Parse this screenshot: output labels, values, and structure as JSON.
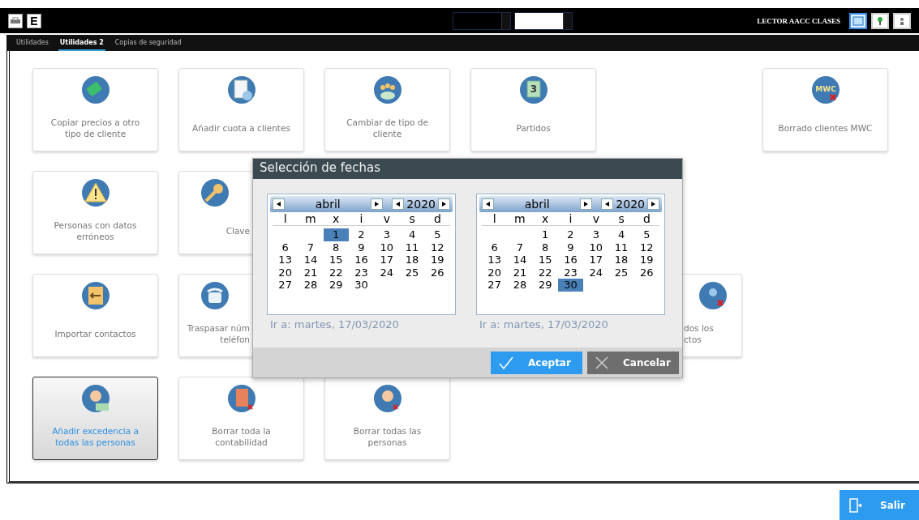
{
  "toolbar": {
    "user": "LECTOR AACC CLASES",
    "left_buttons": [
      {
        "kind": "printer"
      },
      {
        "kind": "letter",
        "label": "E"
      }
    ]
  },
  "tabs": [
    {
      "label": "Utilidades",
      "selected": false
    },
    {
      "label": "Utilidades 2",
      "selected": true
    },
    {
      "label": "Copias de seguridad",
      "selected": false
    }
  ],
  "tiles": [
    {
      "kind": "tile",
      "label": "Copiar precios a otro tipo de cliente",
      "selected": false
    },
    {
      "kind": "tile",
      "label": "Añadir cuota a clientes",
      "selected": false
    },
    {
      "kind": "tile",
      "label": "Cambiar de tipo de cliente",
      "selected": false
    },
    {
      "kind": "tile",
      "label": "Partidos",
      "selected": false,
      "icon_text": "3"
    },
    {
      "kind": "blank"
    },
    {
      "kind": "tile",
      "label": "Borrado clientes MWC",
      "selected": false,
      "icon_text": "MWC"
    },
    {
      "kind": "tile",
      "label": "Personas con datos erróneos",
      "selected": false
    },
    {
      "kind": "cutright",
      "label": "Clave",
      "selected": false
    },
    {
      "kind": "blank"
    },
    {
      "kind": "blank"
    },
    {
      "kind": "blank"
    },
    {
      "kind": "blank"
    },
    {
      "kind": "tile",
      "label": "Importar contactos",
      "selected": false
    },
    {
      "kind": "cutright",
      "label": "Traspasar núm\nteléfon",
      "selected": false
    },
    {
      "kind": "blank"
    },
    {
      "kind": "blank"
    },
    {
      "kind": "cutleft",
      "label": "dos los\nctos",
      "selected": false
    },
    {
      "kind": "blank"
    },
    {
      "kind": "tile",
      "label": "Añadir excedencia a todas las personas",
      "selected": true
    },
    {
      "kind": "tile",
      "label": "Borrar toda la contabilidad",
      "selected": false
    },
    {
      "kind": "tile",
      "label": "Borrar todas las personas",
      "selected": false
    }
  ],
  "dialog": {
    "title": "Selección de fechas",
    "calendars": [
      {
        "month": "abril",
        "year": "2020",
        "weekdays": [
          "l",
          "m",
          "x",
          "i",
          "v",
          "s",
          "d"
        ],
        "goto": "Ir a: martes, 17/03/2020",
        "weeks": [
          {
            "kind": "first",
            "days": [
              {
                "day": "1",
                "selected": true
              },
              {
                "day": "2",
                "selected": false
              },
              {
                "day": "3",
                "selected": false
              },
              {
                "day": "4",
                "selected": false
              },
              {
                "day": "5",
                "selected": false
              }
            ]
          },
          {
            "kind": "full",
            "days": [
              {
                "day": "6",
                "selected": false
              },
              {
                "day": "7",
                "selected": false
              },
              {
                "day": "8",
                "selected": false
              },
              {
                "day": "9",
                "selected": false
              },
              {
                "day": "10",
                "selected": false
              },
              {
                "day": "11",
                "selected": false
              },
              {
                "day": "12",
                "selected": false
              }
            ]
          },
          {
            "kind": "full",
            "days": [
              {
                "day": "13",
                "selected": false
              },
              {
                "day": "14",
                "selected": false
              },
              {
                "day": "15",
                "selected": false
              },
              {
                "day": "16",
                "selected": false
              },
              {
                "day": "17",
                "selected": false
              },
              {
                "day": "18",
                "selected": false
              },
              {
                "day": "19",
                "selected": false
              }
            ]
          },
          {
            "kind": "full",
            "days": [
              {
                "day": "20",
                "selected": false
              },
              {
                "day": "21",
                "selected": false
              },
              {
                "day": "22",
                "selected": false
              },
              {
                "day": "23",
                "selected": false
              },
              {
                "day": "24",
                "selected": false
              },
              {
                "day": "25",
                "selected": false
              },
              {
                "day": "26",
                "selected": false
              }
            ]
          },
          {
            "kind": "last",
            "days": [
              {
                "day": "27",
                "selected": false
              },
              {
                "day": "28",
                "selected": false
              },
              {
                "day": "29",
                "selected": false
              },
              {
                "day": "30",
                "selected": false
              }
            ]
          }
        ]
      },
      {
        "month": "abril",
        "year": "2020",
        "weekdays": [
          "l",
          "m",
          "x",
          "i",
          "v",
          "s",
          "d"
        ],
        "goto": "Ir a: martes, 17/03/2020",
        "weeks": [
          {
            "kind": "first",
            "days": [
              {
                "day": "1",
                "selected": false
              },
              {
                "day": "2",
                "selected": false
              },
              {
                "day": "3",
                "selected": false
              },
              {
                "day": "4",
                "selected": false
              },
              {
                "day": "5",
                "selected": false
              }
            ]
          },
          {
            "kind": "full",
            "days": [
              {
                "day": "6",
                "selected": false
              },
              {
                "day": "7",
                "selected": false
              },
              {
                "day": "8",
                "selected": false
              },
              {
                "day": "9",
                "selected": false
              },
              {
                "day": "10",
                "selected": false
              },
              {
                "day": "11",
                "selected": false
              },
              {
                "day": "12",
                "selected": false
              }
            ]
          },
          {
            "kind": "full",
            "days": [
              {
                "day": "13",
                "selected": false
              },
              {
                "day": "14",
                "selected": false
              },
              {
                "day": "15",
                "selected": false
              },
              {
                "day": "16",
                "selected": false
              },
              {
                "day": "17",
                "selected": false
              },
              {
                "day": "18",
                "selected": false
              },
              {
                "day": "19",
                "selected": false
              }
            ]
          },
          {
            "kind": "full",
            "days": [
              {
                "day": "20",
                "selected": false
              },
              {
                "day": "21",
                "selected": false
              },
              {
                "day": "22",
                "selected": false
              },
              {
                "day": "23",
                "selected": false
              },
              {
                "day": "24",
                "selected": false
              },
              {
                "day": "25",
                "selected": false
              },
              {
                "day": "26",
                "selected": false
              }
            ]
          },
          {
            "kind": "last",
            "days": [
              {
                "day": "27",
                "selected": false
              },
              {
                "day": "28",
                "selected": false
              },
              {
                "day": "29",
                "selected": false
              },
              {
                "day": "30",
                "selected": true
              }
            ]
          }
        ]
      }
    ],
    "buttons": [
      {
        "kind": "accept",
        "label": "Aceptar"
      },
      {
        "kind": "cancel",
        "label": "Cancelar"
      }
    ]
  },
  "exit_button": {
    "label": "Salir"
  }
}
